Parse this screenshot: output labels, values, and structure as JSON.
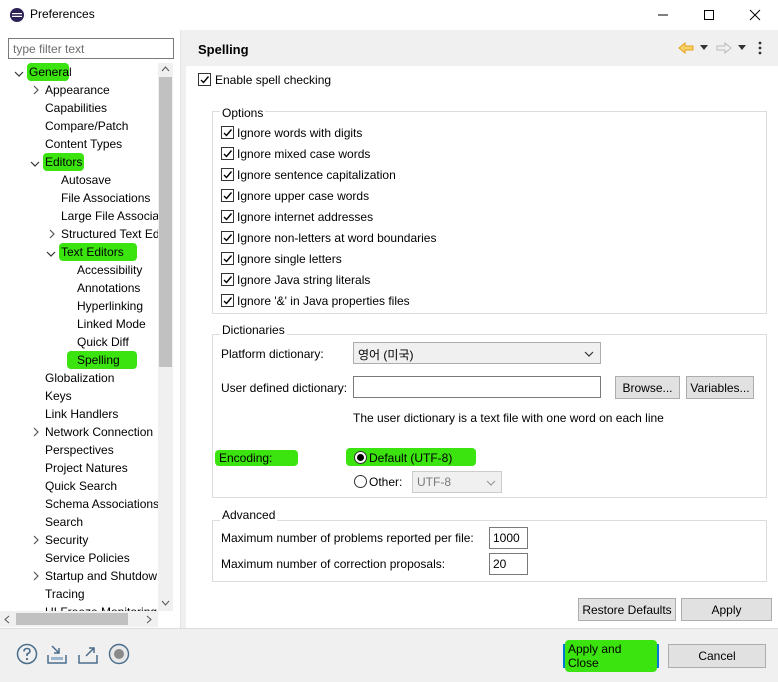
{
  "window": {
    "title": "Preferences"
  },
  "filter": {
    "placeholder": "type filter text"
  },
  "tree": [
    "General",
    "Appearance",
    "Capabilities",
    "Compare/Patch",
    "Content Types",
    "Editors",
    "Autosave",
    "File Associations",
    "Large File Associati",
    "Structured Text Ed",
    "Text Editors",
    "Accessibility",
    "Annotations",
    "Hyperlinking",
    "Linked Mode",
    "Quick Diff",
    "Spelling",
    "Globalization",
    "Keys",
    "Link Handlers",
    "Network Connection",
    "Perspectives",
    "Project Natures",
    "Quick Search",
    "Schema Associations",
    "Search",
    "Security",
    "Service Policies",
    "Startup and Shutdow",
    "Tracing",
    "UI Freeze Monitoring"
  ],
  "page": {
    "title": "Spelling",
    "enable_label": "Enable spell checking",
    "options_title": "Options",
    "options": [
      "Ignore words with digits",
      "Ignore mixed case words",
      "Ignore sentence capitalization",
      "Ignore upper case words",
      "Ignore internet addresses",
      "Ignore non-letters at word boundaries",
      "Ignore single letters",
      "Ignore Java string literals",
      "Ignore '&' in Java properties files"
    ],
    "dictionaries_title": "Dictionaries",
    "platform_dict_label": "Platform dictionary:",
    "platform_dict_value": "영어 (미국)",
    "user_dict_label": "User defined dictionary:",
    "user_dict_value": "",
    "browse_label": "Browse...",
    "variables_label": "Variables...",
    "user_dict_note": "The user dictionary is a text file with one word on each line",
    "encoding_label": "Encoding:",
    "default_encoding_label": "Default (UTF-8)",
    "other_label": "Other:",
    "other_value": "UTF-8",
    "advanced_title": "Advanced",
    "max_problems_label": "Maximum number of problems reported per file:",
    "max_problems_value": "1000",
    "max_proposals_label": "Maximum number of correction proposals:",
    "max_proposals_value": "20",
    "restore_label": "Restore Defaults",
    "apply_label": "Apply"
  },
  "footer": {
    "apply_close_label": "Apply and Close",
    "cancel_label": "Cancel"
  },
  "colors": {
    "highlight": "#3be30f",
    "focus_border": "#0078d7",
    "back_arrow": "#e8a21a"
  }
}
